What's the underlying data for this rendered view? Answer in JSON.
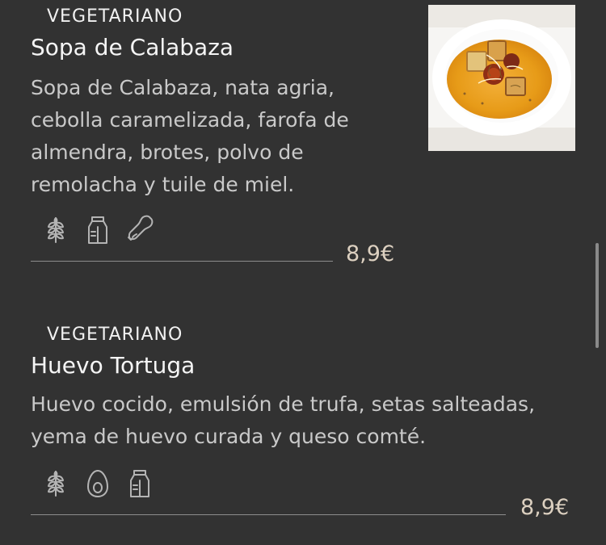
{
  "menu": {
    "items": [
      {
        "tag": "VEGETARIANO",
        "title": "Sopa de Calabaza",
        "description_lines": [
          "Sopa de Calabaza, nata agria,",
          "cebolla caramelizada, farofa de",
          "almendra, brotes, polvo de",
          "remolacha y tuile de miel."
        ],
        "icons": [
          "wheat-icon",
          "milk-icon",
          "peanut-icon"
        ],
        "price": "8,9€"
      },
      {
        "tag": "VEGETARIANO",
        "title": "Huevo Tortuga",
        "description_lines": [
          "Huevo cocido, emulsión de trufa, setas salteadas,",
          "yema de huevo curada y queso comté."
        ],
        "icons": [
          "wheat-icon",
          "egg-icon",
          "milk-icon"
        ],
        "price": "8,9€"
      }
    ]
  },
  "colors": {
    "background": "#323232",
    "text": "#f5f5f5",
    "description": "#c9c9c9",
    "price": "#dcd0c0",
    "divider": "#8d8d8d"
  }
}
